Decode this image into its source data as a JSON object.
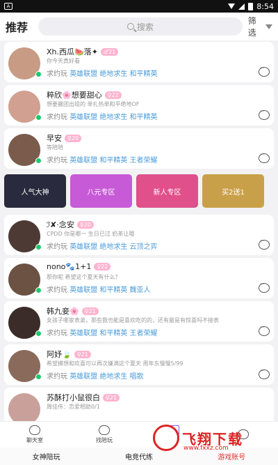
{
  "status": {
    "time": "8:54"
  },
  "header": {
    "title": "推荐",
    "search_placeholder": "搜索",
    "filter": "筛选"
  },
  "games_prefix": "求约玩",
  "cards": [
    {
      "name": "Xh.西瓜🍉落✦",
      "age": "♂21",
      "bio": "你今天真好看",
      "games": "英雄联盟 绝地求生 和平精英",
      "avatar": "#c89b85"
    },
    {
      "name": "粹欣🌸想要甜心",
      "age": "♀22",
      "bio": "想要搬团出组的 单扎热单和平绝地OF",
      "games": "英雄联盟 绝地求生 和平精英",
      "avatar": "#d1a090"
    },
    {
      "name": "早安",
      "age": "♀20",
      "bio": "等陪陪",
      "games": "英雄联盟 和平精英 王者荣耀",
      "avatar": "#7a5b4c"
    },
    {
      "name": "ℐ✘·念安",
      "age": "♀20",
      "bio": "CPDD 你是哪一 生日已过 奶茶让哦",
      "games": "英雄联盟 绝地求生 云顶之弈",
      "avatar": "#4e3a34"
    },
    {
      "name": "nono🐾1+1",
      "age": "♀22",
      "bio": "那你呢 希望这个夏天有什么？",
      "games": "英雄联盟 和平精英 魏亚人",
      "avatar": "#6b5243"
    },
    {
      "name": "韩九妾🌸",
      "age": "♀21",
      "bio": "女孩子哪家表弟，那些我也能是喜欢吃的的，还有最是有惊喜吗不接表",
      "games": "英雄联盟 和平精英 王者荣耀",
      "avatar": "#3b2c2a"
    },
    {
      "name": "阿妤🍃",
      "age": "♀21",
      "bio": "希望摸想和欢喜可以再次嫌满这个夏天 周年东慢慢5/99",
      "games": "英雄联盟 绝地求生 唱歌",
      "avatar": "#8a6b5b"
    },
    {
      "name": "苏酥打小鼠很白",
      "age": "♀21",
      "bio": "周佳伟：恋爱相助0/1",
      "games": "",
      "avatar": "#c9a09a"
    }
  ],
  "banners": [
    {
      "label": "人气大神",
      "color": "#2a2a3e"
    },
    {
      "label": "八元专区",
      "color": "#c75ad6"
    },
    {
      "label": "新人专区",
      "color": "#e0508a"
    },
    {
      "label": "买2送1",
      "color": "#c9a04a"
    }
  ],
  "tabs": [
    {
      "label": "聊天室",
      "icon": "chat-room-icon"
    },
    {
      "label": "找陪玩",
      "icon": "gamepad-icon"
    },
    {
      "label": "推荐",
      "icon": "home-icon"
    },
    {
      "label": "",
      "icon": "profile-icon"
    }
  ],
  "bottom_tabs": [
    "女神陪玩",
    "电竞代练",
    "游戏账号"
  ],
  "watermark": {
    "text": "飞翔下载",
    "url": "www.fxxz.com"
  }
}
